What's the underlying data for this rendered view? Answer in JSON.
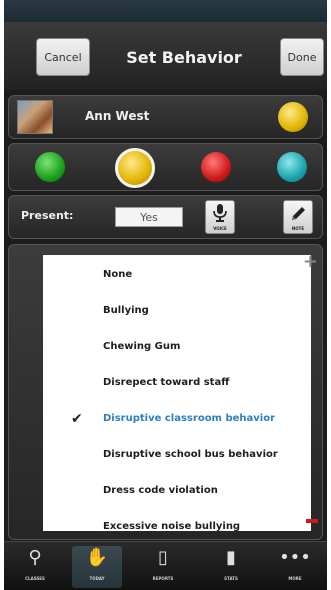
{
  "header": {
    "cancel_label": "Cancel",
    "title": "Set Behavior",
    "done_label": "Done"
  },
  "student": {
    "name": "Ann West",
    "status_color": "#e0b400"
  },
  "behavior_colors": [
    "#1aa01a",
    "#e0b400",
    "#d01818",
    "#1aa4ac"
  ],
  "selected_color": "#e0b400",
  "present": {
    "label": "Present:",
    "value": "Yes"
  },
  "actions": {
    "voice_label": "VOICE",
    "note_label": "NOTE"
  },
  "behaviors": [
    {
      "label": "None",
      "selected": false
    },
    {
      "label": "Bullying",
      "selected": false
    },
    {
      "label": "Chewing Gum",
      "selected": false
    },
    {
      "label": "Disrepect toward staff",
      "selected": false
    },
    {
      "label": "Disruptive classroom behavior",
      "selected": true
    },
    {
      "label": "Disruptive school bus behavior",
      "selected": false
    },
    {
      "label": "Dress code violation",
      "selected": false
    },
    {
      "label": "Excessive noise bullying",
      "selected": false
    }
  ],
  "tabs": [
    {
      "label": "CLASSES",
      "icon": "antenna-icon",
      "active": false
    },
    {
      "label": "TODAY",
      "icon": "hand-icon",
      "active": true
    },
    {
      "label": "REPORTS",
      "icon": "document-icon",
      "active": false
    },
    {
      "label": "STATS",
      "icon": "bar-chart-icon",
      "active": false
    },
    {
      "label": "MORE",
      "icon": "more-dots-icon",
      "active": false
    }
  ]
}
